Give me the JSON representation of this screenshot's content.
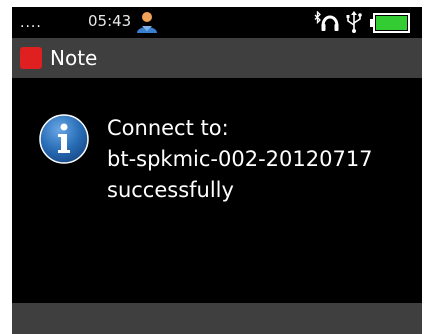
{
  "status_bar": {
    "signal": "....",
    "time": "05:43",
    "icons": [
      "person-icon",
      "bluetooth-headset-icon",
      "usb-icon",
      "battery-icon"
    ],
    "battery_color": "#33cc33"
  },
  "dialog": {
    "title": "Note",
    "title_icon_color": "#e02020",
    "icon": "info-icon",
    "message_lines": [
      "Connect to:",
      "bt-spkmic-002-20120717",
      "successfully"
    ]
  },
  "colors": {
    "background": "#000000",
    "bar": "#3f3f3f",
    "info_blue": "#2a6fb8"
  }
}
